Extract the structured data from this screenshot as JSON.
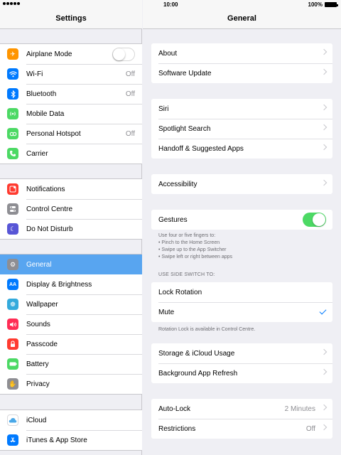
{
  "status": {
    "time": "10:00",
    "battery": "100%"
  },
  "master": {
    "title": "Settings",
    "groups": [
      {
        "items": [
          {
            "label": "Airplane Mode",
            "icon": "airplane-icon",
            "color": "#ff9500",
            "control": "toggle-off"
          },
          {
            "label": "Wi-Fi",
            "icon": "wifi-icon",
            "color": "#007aff",
            "value": "Off"
          },
          {
            "label": "Bluetooth",
            "icon": "bluetooth-icon",
            "color": "#007aff",
            "value": "Off"
          },
          {
            "label": "Mobile Data",
            "icon": "mobile-data-icon",
            "color": "#4cd964"
          },
          {
            "label": "Personal Hotspot",
            "icon": "hotspot-icon",
            "color": "#4cd964",
            "value": "Off"
          },
          {
            "label": "Carrier",
            "icon": "phone-icon",
            "color": "#4cd964"
          }
        ]
      },
      {
        "items": [
          {
            "label": "Notifications",
            "icon": "notifications-icon",
            "color": "#ff3b30"
          },
          {
            "label": "Control Centre",
            "icon": "control-centre-icon",
            "color": "#8e8e93"
          },
          {
            "label": "Do Not Disturb",
            "icon": "moon-icon",
            "color": "#5856d6"
          }
        ]
      },
      {
        "items": [
          {
            "label": "General",
            "icon": "gear-icon",
            "color": "#8e8e93",
            "selected": true
          },
          {
            "label": "Display & Brightness",
            "icon": "display-icon",
            "color": "#007aff"
          },
          {
            "label": "Wallpaper",
            "icon": "wallpaper-icon",
            "color": "#34aadc"
          },
          {
            "label": "Sounds",
            "icon": "speaker-icon",
            "color": "#ff2d55"
          },
          {
            "label": "Passcode",
            "icon": "lock-icon",
            "color": "#ff3b30"
          },
          {
            "label": "Battery",
            "icon": "battery-icon",
            "color": "#4cd964"
          },
          {
            "label": "Privacy",
            "icon": "hand-icon",
            "color": "#8e8e93"
          }
        ]
      },
      {
        "items": [
          {
            "label": "iCloud",
            "icon": "cloud-icon",
            "color": "#ffffff"
          },
          {
            "label": "iTunes & App Store",
            "icon": "app-store-icon",
            "color": "#007aff"
          }
        ]
      }
    ]
  },
  "detail": {
    "title": "General",
    "about": "About",
    "software_update": "Software Update",
    "siri": "Siri",
    "spotlight": "Spotlight Search",
    "handoff": "Handoff & Suggested Apps",
    "accessibility": "Accessibility",
    "gestures": "Gestures",
    "gestures_note_1": "Use four or five fingers to:",
    "gestures_note_2": "• Pinch to the Home Screen",
    "gestures_note_3": "• Swipe up to the App Switcher",
    "gestures_note_4": "• Swipe left or right between apps",
    "side_switch_title": "USE SIDE SWITCH TO:",
    "lock_rotation": "Lock Rotation",
    "mute": "Mute",
    "rotation_note": "Rotation Lock is available in Control Centre.",
    "storage": "Storage & iCloud Usage",
    "background_refresh": "Background App Refresh",
    "auto_lock": "Auto-Lock",
    "auto_lock_value": "2 Minutes",
    "restrictions": "Restrictions",
    "restrictions_value": "Off"
  }
}
